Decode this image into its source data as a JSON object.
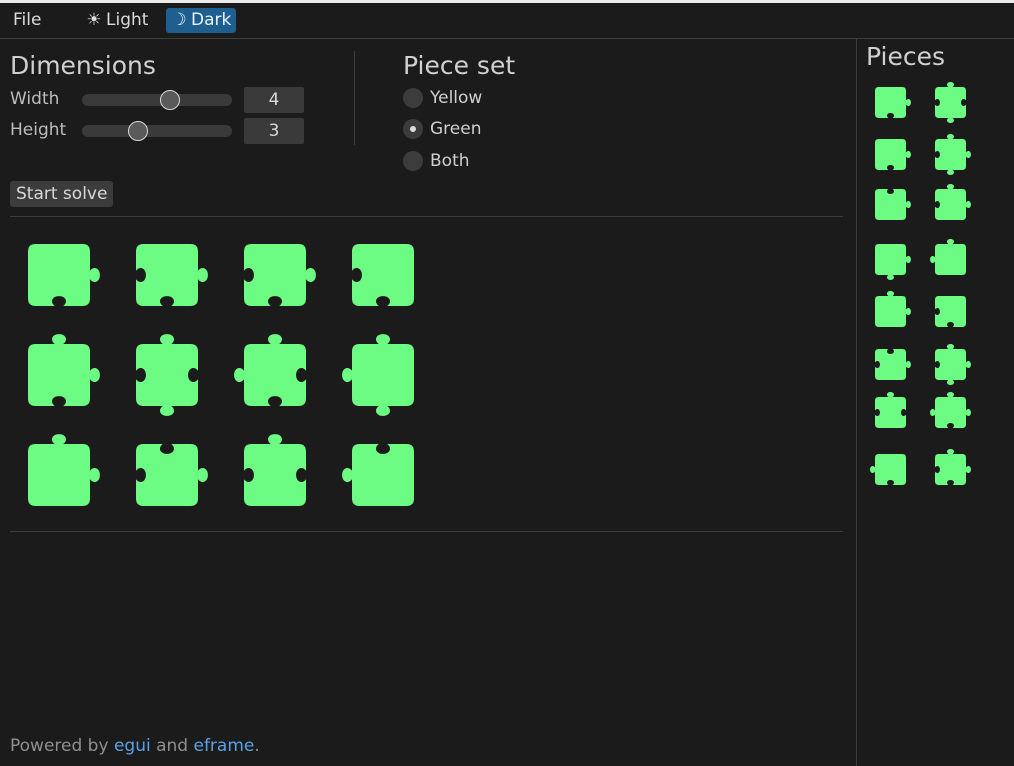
{
  "menu": {
    "file_label": "File",
    "light_label": "Light",
    "dark_label": "Dark",
    "light_icon": "sun-icon",
    "dark_icon": "moon-icon",
    "selected_theme": "Dark"
  },
  "dimensions": {
    "title": "Dimensions",
    "width_label": "Width",
    "width_value": "4",
    "width_slider": 0.6,
    "height_label": "Height",
    "height_value": "3",
    "height_slider": 0.35
  },
  "piece_set": {
    "title": "Piece set",
    "options": [
      "Yellow",
      "Green",
      "Both"
    ],
    "selected": "Green"
  },
  "actions": {
    "start_solve_label": "Start solve"
  },
  "board": {
    "columns": 4,
    "rows": 3,
    "piece_color": "#6cfb83"
  },
  "sidebar": {
    "title": "Pieces",
    "piece_count": 16
  },
  "footer": {
    "prefix": "Powered by",
    "link1": "egui",
    "middle": "and",
    "link2": "eframe",
    "suffix": "."
  },
  "colors": {
    "background": "#1b1b1b",
    "accent": "#1f5f8f",
    "link": "#5aa2e6",
    "piece": "#6cfb83"
  }
}
